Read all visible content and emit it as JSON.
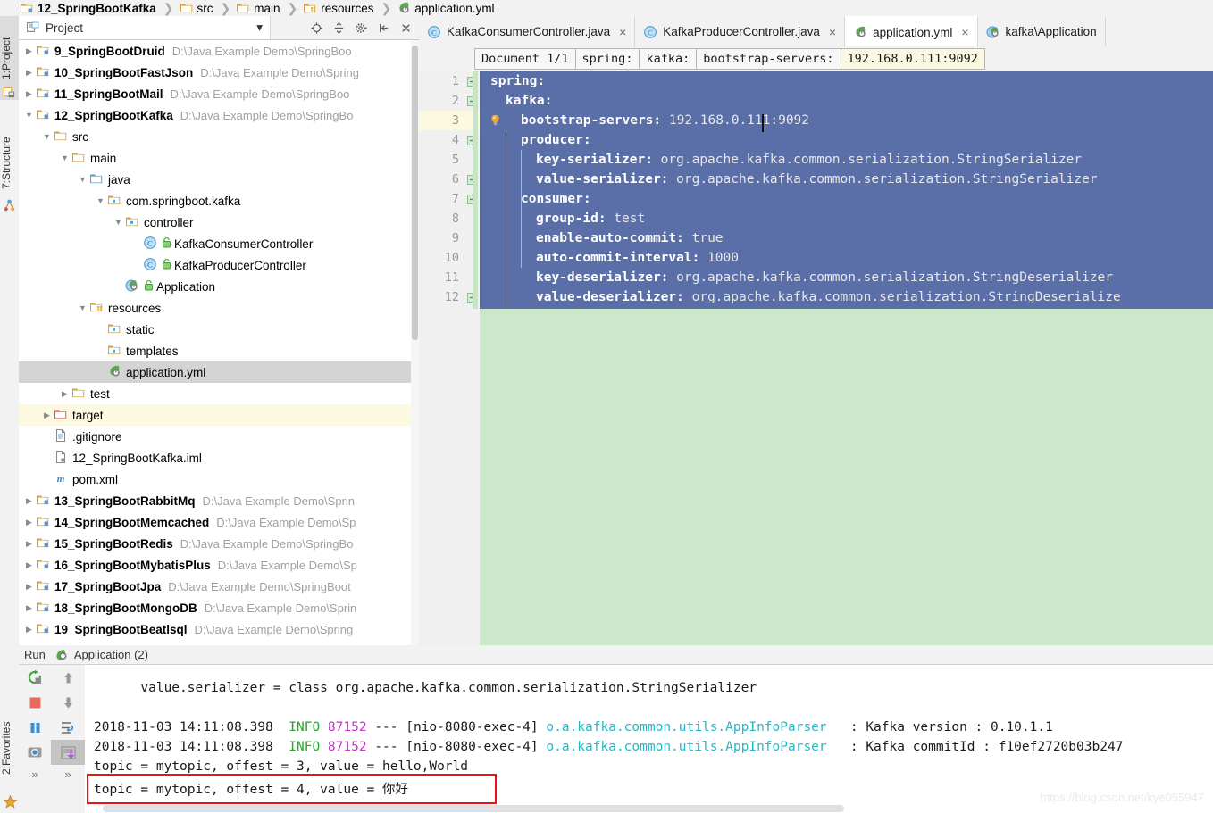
{
  "breadcrumb": [
    {
      "label": "12_SpringBootKafka",
      "icon": "module-folder-icon",
      "bold": true
    },
    {
      "label": "src",
      "icon": "folder-icon",
      "bold": false
    },
    {
      "label": "main",
      "icon": "folder-icon",
      "bold": false
    },
    {
      "label": "resources",
      "icon": "resources-folder-icon",
      "bold": false
    },
    {
      "label": "application.yml",
      "icon": "spring-yml-icon",
      "bold": false
    }
  ],
  "left_tool_tabs": [
    {
      "label": "1:Project",
      "icon": "project-icon",
      "selected": true
    },
    {
      "label": "7:Structure",
      "icon": "structure-icon",
      "selected": false
    }
  ],
  "bottom_tool_tabs": [
    {
      "label": "2:Favorites",
      "icon": "star-icon",
      "selected": false
    }
  ],
  "project_panel": {
    "title": "Project",
    "caret": "▾",
    "tools": [
      {
        "name": "locate-icon",
        "glyph": "⊕"
      },
      {
        "name": "expand-collapse-icon",
        "glyph": "÷"
      },
      {
        "name": "settings-gear-icon",
        "glyph": "⚙"
      },
      {
        "name": "hide-icon",
        "glyph": "⮨"
      },
      {
        "name": "close-icon",
        "glyph": "×"
      }
    ]
  },
  "tree": [
    {
      "indent": 0,
      "twisty": "▶",
      "icon": "module-folder-icon",
      "label": "9_SpringBootDruid",
      "bold": true,
      "path": "D:\\Java Example Demo\\SpringBoo",
      "state": "normal"
    },
    {
      "indent": 0,
      "twisty": "▶",
      "icon": "module-folder-icon",
      "label": "10_SpringBootFastJson",
      "bold": true,
      "path": "D:\\Java Example Demo\\Spring",
      "state": "normal"
    },
    {
      "indent": 0,
      "twisty": "▶",
      "icon": "module-folder-icon",
      "label": "11_SpringBootMail",
      "bold": true,
      "path": "D:\\Java Example Demo\\SpringBoo",
      "state": "normal"
    },
    {
      "indent": 0,
      "twisty": "▼",
      "icon": "module-folder-icon",
      "label": "12_SpringBootKafka",
      "bold": true,
      "path": "D:\\Java Example Demo\\SpringBo",
      "state": "normal"
    },
    {
      "indent": 1,
      "twisty": "▼",
      "icon": "folder-icon",
      "label": "src",
      "bold": false,
      "path": "",
      "state": "normal"
    },
    {
      "indent": 2,
      "twisty": "▼",
      "icon": "folder-icon",
      "label": "main",
      "bold": false,
      "path": "",
      "state": "normal"
    },
    {
      "indent": 3,
      "twisty": "▼",
      "icon": "source-folder-icon",
      "label": "java",
      "bold": false,
      "path": "",
      "state": "normal"
    },
    {
      "indent": 4,
      "twisty": "▼",
      "icon": "package-icon",
      "label": "com.springboot.kafka",
      "bold": false,
      "path": "",
      "state": "normal"
    },
    {
      "indent": 5,
      "twisty": "▼",
      "icon": "package-icon",
      "label": "controller",
      "bold": false,
      "path": "",
      "state": "normal"
    },
    {
      "indent": 6,
      "twisty": "",
      "icon": "java-class-icon",
      "lock": true,
      "label": "KafkaConsumerController",
      "bold": false,
      "path": "",
      "state": "normal"
    },
    {
      "indent": 6,
      "twisty": "",
      "icon": "java-class-icon",
      "lock": true,
      "label": "KafkaProducerController",
      "bold": false,
      "path": "",
      "state": "normal"
    },
    {
      "indent": 5,
      "twisty": "",
      "icon": "spring-boot-class-icon",
      "lock": true,
      "label": "Application",
      "bold": false,
      "path": "",
      "state": "normal"
    },
    {
      "indent": 3,
      "twisty": "▼",
      "icon": "resources-folder-icon",
      "label": "resources",
      "bold": false,
      "path": "",
      "state": "normal"
    },
    {
      "indent": 4,
      "twisty": "",
      "icon": "package-icon",
      "label": "static",
      "bold": false,
      "path": "",
      "state": "normal"
    },
    {
      "indent": 4,
      "twisty": "",
      "icon": "package-icon",
      "label": "templates",
      "bold": false,
      "path": "",
      "state": "normal"
    },
    {
      "indent": 4,
      "twisty": "",
      "icon": "spring-yml-icon",
      "label": "application.yml",
      "bold": false,
      "path": "",
      "state": "selected"
    },
    {
      "indent": 2,
      "twisty": "▶",
      "icon": "folder-icon",
      "label": "test",
      "bold": false,
      "path": "",
      "state": "normal"
    },
    {
      "indent": 1,
      "twisty": "▶",
      "icon": "excluded-folder-icon",
      "label": "target",
      "bold": false,
      "path": "",
      "state": "highlight"
    },
    {
      "indent": 1,
      "twisty": "",
      "icon": "text-file-icon",
      "label": ".gitignore",
      "bold": false,
      "path": "",
      "state": "normal"
    },
    {
      "indent": 1,
      "twisty": "",
      "icon": "iml-file-icon",
      "label": "12_SpringBootKafka.iml",
      "bold": false,
      "path": "",
      "state": "normal"
    },
    {
      "indent": 1,
      "twisty": "",
      "icon": "maven-icon",
      "label": "pom.xml",
      "bold": false,
      "path": "",
      "state": "normal"
    },
    {
      "indent": 0,
      "twisty": "▶",
      "icon": "module-folder-icon",
      "label": "13_SpringBootRabbitMq",
      "bold": true,
      "path": "D:\\Java Example Demo\\Sprin",
      "state": "normal"
    },
    {
      "indent": 0,
      "twisty": "▶",
      "icon": "module-folder-icon",
      "label": "14_SpringBootMemcached",
      "bold": true,
      "path": "D:\\Java Example Demo\\Sp",
      "state": "normal"
    },
    {
      "indent": 0,
      "twisty": "▶",
      "icon": "module-folder-icon",
      "label": "15_SpringBootRedis",
      "bold": true,
      "path": "D:\\Java Example Demo\\SpringBo",
      "state": "normal"
    },
    {
      "indent": 0,
      "twisty": "▶",
      "icon": "module-folder-icon",
      "label": "16_SpringBootMybatisPlus",
      "bold": true,
      "path": "D:\\Java Example Demo\\Sp",
      "state": "normal"
    },
    {
      "indent": 0,
      "twisty": "▶",
      "icon": "module-folder-icon",
      "label": "17_SpringBootJpa",
      "bold": true,
      "path": "D:\\Java Example Demo\\SpringBoot",
      "state": "normal"
    },
    {
      "indent": 0,
      "twisty": "▶",
      "icon": "module-folder-icon",
      "label": "18_SpringBootMongoDB",
      "bold": true,
      "path": "D:\\Java Example Demo\\Sprin",
      "state": "normal"
    },
    {
      "indent": 0,
      "twisty": "▶",
      "icon": "module-folder-icon",
      "label": "19_SpringBootBeatlsql",
      "bold": true,
      "path": "D:\\Java Example Demo\\Spring",
      "state": "normal"
    }
  ],
  "editor_tabs": [
    {
      "label": "KafkaConsumerController.java",
      "icon": "java-class-icon",
      "active": false,
      "close": "×"
    },
    {
      "label": "KafkaProducerController.java",
      "icon": "java-class-icon",
      "active": false,
      "close": "×"
    },
    {
      "label": "application.yml",
      "icon": "spring-yml-icon",
      "active": true,
      "close": "×"
    },
    {
      "label": "kafka\\Application",
      "icon": "spring-boot-class-icon",
      "active": false,
      "close": ""
    }
  ],
  "editor_breadcrumbs": [
    {
      "label": "Document 1/1",
      "value": false
    },
    {
      "label": "spring:",
      "value": false
    },
    {
      "label": "kafka:",
      "value": false
    },
    {
      "label": "bootstrap-servers:",
      "value": false
    },
    {
      "label": "192.168.0.111:9092",
      "value": true
    }
  ],
  "code": {
    "lines": [
      {
        "num": "1",
        "indent": 0,
        "key": "spring:",
        "value": "",
        "fold": "minus"
      },
      {
        "num": "2",
        "indent": 1,
        "key": "kafka:",
        "value": "",
        "fold": "minus"
      },
      {
        "num": "3",
        "indent": 2,
        "key": "bootstrap-servers:",
        "value": " 192.168.0.111:9092",
        "fold": "bulb"
      },
      {
        "num": "4",
        "indent": 2,
        "key": "producer:",
        "value": "",
        "fold": "minus"
      },
      {
        "num": "5",
        "indent": 3,
        "key": "key-serializer:",
        "value": " org.apache.kafka.common.serialization.StringSerializer",
        "fold": ""
      },
      {
        "num": "6",
        "indent": 3,
        "key": "value-serializer:",
        "value": " org.apache.kafka.common.serialization.StringSerializer",
        "fold": "minus"
      },
      {
        "num": "7",
        "indent": 2,
        "key": "consumer:",
        "value": "",
        "fold": "minus"
      },
      {
        "num": "8",
        "indent": 3,
        "key": "group-id:",
        "value": " test",
        "fold": ""
      },
      {
        "num": "9",
        "indent": 3,
        "key": "enable-auto-commit:",
        "value": " true",
        "fold": ""
      },
      {
        "num": "10",
        "indent": 3,
        "key": "auto-commit-interval:",
        "value": " 1000",
        "fold": ""
      },
      {
        "num": "11",
        "indent": 3,
        "key": "key-deserializer:",
        "value": " org.apache.kafka.common.serialization.StringDeserializer",
        "fold": ""
      },
      {
        "num": "12",
        "indent": 3,
        "key": "value-deserializer:",
        "value": " org.apache.kafka.common.serialization.StringDeserialize",
        "fold": "minus"
      }
    ]
  },
  "run_panel": {
    "run_label": "Run",
    "title": "Application (2)",
    "icon": "spring-boot-class-icon",
    "tools_left": [
      {
        "name": "rerun-icon",
        "glyph": "↻"
      },
      {
        "name": "stop-icon",
        "glyph": "■"
      },
      {
        "name": "pause-icon",
        "glyph": "‖"
      },
      {
        "name": "dump-threads-icon",
        "glyph": "◎"
      },
      {
        "name": "expand-more-icon",
        "glyph": "»"
      }
    ],
    "tools_right": [
      {
        "name": "scroll-up-icon",
        "glyph": "↑"
      },
      {
        "name": "scroll-down-icon",
        "glyph": "↓"
      },
      {
        "name": "soft-wrap-icon",
        "glyph": "⇄"
      },
      {
        "name": "scroll-to-end-icon",
        "glyph": "⬇"
      },
      {
        "name": "expand-more-icon",
        "glyph": "»"
      }
    ],
    "console_lines": [
      {
        "type": "plain",
        "text": "      value.serializer = class org.apache.kafka.common.serialization.StringSerializer"
      },
      {
        "type": "blank",
        "text": ""
      },
      {
        "type": "log",
        "ts": "2018-11-03 14:11:08.398",
        "level": "INFO",
        "pid": "87152",
        "sep": "--- [nio-8080-exec-4]",
        "logger": "o.a.kafka.common.utils.AppInfoParser",
        "msg": ": Kafka version : 0.10.1.1"
      },
      {
        "type": "log",
        "ts": "2018-11-03 14:11:08.398",
        "level": "INFO",
        "pid": "87152",
        "sep": "--- [nio-8080-exec-4]",
        "logger": "o.a.kafka.common.utils.AppInfoParser",
        "msg": ": Kafka commitId : f10ef2720b03b247"
      },
      {
        "type": "plain",
        "text": "topic = mytopic, offest = 3, value = hello,World"
      },
      {
        "type": "plain",
        "text": "topic = mytopic, offest = 4, value = 你好",
        "highlight": true
      }
    ]
  },
  "watermark": "https://blog.csdn.net/kye055947",
  "colors": {
    "selection": "#5a6fa8",
    "editor_bg": "#cbe8cb",
    "highlight_box": "#ee1111",
    "tree_selected": "#d4d4d4",
    "tree_highlight": "#fdf8e0"
  }
}
